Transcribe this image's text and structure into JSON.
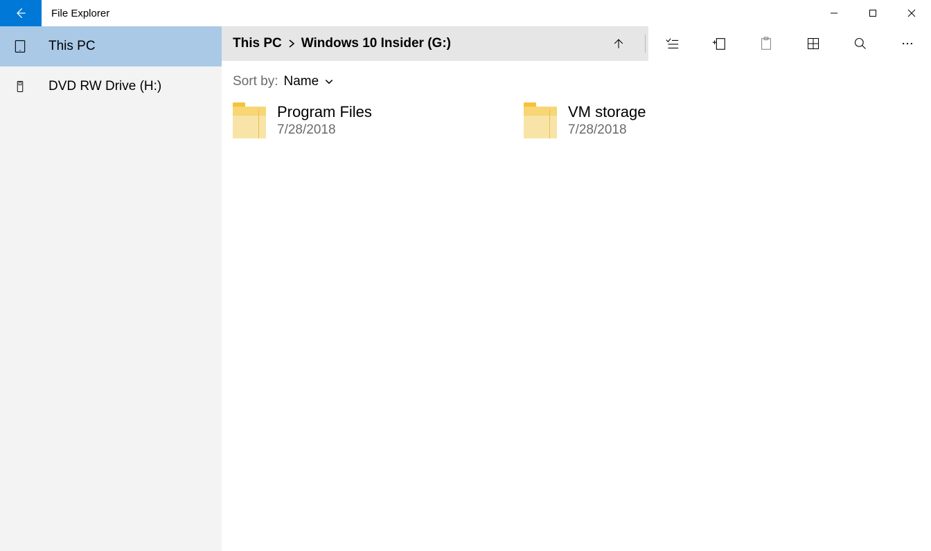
{
  "title": "File Explorer",
  "sidebar": {
    "items": [
      {
        "label": "This PC",
        "icon": "tablet",
        "active": true
      },
      {
        "label": "DVD RW Drive (H:)",
        "icon": "usb",
        "active": false
      }
    ]
  },
  "breadcrumb": {
    "parts": [
      "This PC",
      "Windows 10 Insider (G:)"
    ]
  },
  "sort": {
    "label": "Sort by:",
    "value": "Name"
  },
  "items": [
    {
      "name": "Program Files",
      "date": "7/28/2018"
    },
    {
      "name": "VM storage",
      "date": "7/28/2018"
    }
  ],
  "toolbar_icons": [
    "up",
    "list-select",
    "new-item",
    "paste",
    "view-grid",
    "search",
    "more"
  ]
}
